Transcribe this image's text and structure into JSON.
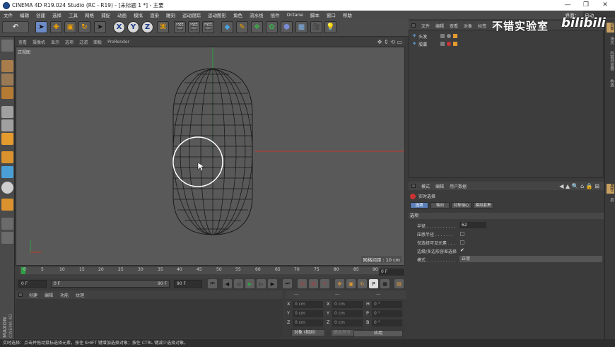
{
  "window": {
    "title": "CINEMA 4D R19.024 Studio (RC - R19) - [未标题 1 *] - 主要",
    "minimize": "—",
    "maximize": "❐",
    "close": "✕"
  },
  "menubar": {
    "items": [
      "文件",
      "编辑",
      "创建",
      "选择",
      "工具",
      "网格",
      "捕捉",
      "动画",
      "模拟",
      "渲染",
      "雕刻",
      "运动跟踪",
      "运动图形",
      "角色",
      "流水线",
      "插件",
      "Octane",
      "脚本",
      "窗口",
      "帮助"
    ],
    "layout_label": "界面：",
    "layout_value": "启动"
  },
  "watermark": {
    "text": "不错实验室",
    "brand": "bilibili"
  },
  "viewport": {
    "menu": [
      "查看",
      "摄像机",
      "显示",
      "选项",
      "过滤",
      "面板",
      "ProRender"
    ],
    "name": "正视图",
    "grid_info": "网格间距 : 10 cm"
  },
  "timeline": {
    "ticks": [
      "0",
      "5",
      "10",
      "15",
      "20",
      "25",
      "30",
      "35",
      "40",
      "45",
      "50",
      "55",
      "60",
      "65",
      "70",
      "75",
      "80",
      "85",
      "90"
    ],
    "current_frame": "0 F"
  },
  "transport": {
    "start": "0 F",
    "preview_start": "0 F",
    "preview_end": "90 F",
    "end": "90 F"
  },
  "material_panel": {
    "menu": [
      "创建",
      "编辑",
      "功能",
      "纹理"
    ]
  },
  "coordinates": {
    "header": "---",
    "rows": [
      {
        "label": "X",
        "pos": "0 cm",
        "label2": "X",
        "size": "0 cm",
        "label3": "H",
        "rot": "0 °"
      },
      {
        "label": "Y",
        "pos": "0 cm",
        "label2": "Y",
        "size": "0 cm",
        "label3": "P",
        "rot": "0 °"
      },
      {
        "label": "Z",
        "pos": "0 cm",
        "label2": "Z",
        "size": "0 cm",
        "label3": "B",
        "rot": "0 °"
      }
    ],
    "mode": "对象 (相对)",
    "size_mode": "绝对尺寸",
    "apply": "应用"
  },
  "object_manager": {
    "menu": [
      "文件",
      "编辑",
      "查看",
      "对象",
      "标签",
      "书签"
    ],
    "objects": [
      {
        "name": "头发"
      },
      {
        "name": "胶囊"
      }
    ]
  },
  "attribute_manager": {
    "menu": [
      "模式",
      "编辑",
      "用户数据"
    ],
    "tool_name": "实时选择",
    "tabs": [
      "选项",
      "轴向",
      "对象轴心",
      "模拟套黑"
    ],
    "section": "选项",
    "fields": [
      {
        "label": "半径 . . . . . . . . . . .",
        "value": "62"
      },
      {
        "label": "压感半径 . . . . . . .",
        "value": ""
      },
      {
        "label": "仅选择可见元素 . . .",
        "value": ""
      },
      {
        "label": "边缘/多边形容差选择",
        "value": "✔"
      },
      {
        "label": "模式 . . . . . . . . . . .",
        "value": "正常"
      }
    ]
  },
  "right_strip": [
    "对象",
    "场次",
    "内容浏览器",
    "构造",
    "属性",
    "层"
  ],
  "statusbar": {
    "text": "实时选择：点击并拖动鼠标选择元素。按住 SHIFT 键增加选择对象；按住 CTRL 键减少选择对象。"
  },
  "maxon": {
    "line1": "MAXON",
    "line2": "CINEMA 4D"
  },
  "colors": {
    "accent": "#5a7fb8",
    "axis_green": "#2ea043",
    "axis_red": "#c0392b",
    "selection_circle": "#ffffff"
  }
}
